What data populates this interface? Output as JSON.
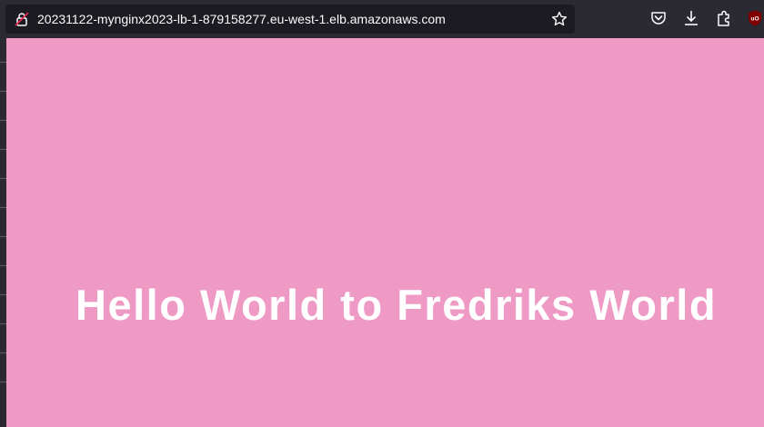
{
  "browser": {
    "url": "20231122-mynginx2023-lb-1-879158277.eu-west-1.elb.amazonaws.com",
    "icons": {
      "site_info": "lock-warning-icon",
      "bookmark": "star-icon",
      "pocket": "pocket-icon",
      "downloads": "download-icon",
      "extensions": "extensions-icon",
      "ublock": "ublock-origin-icon"
    },
    "ublock_badge": "uO"
  },
  "page": {
    "heading": "Hello World to Fredriks World",
    "background_color": "#ef99c5",
    "text_color": "#ffffff"
  }
}
